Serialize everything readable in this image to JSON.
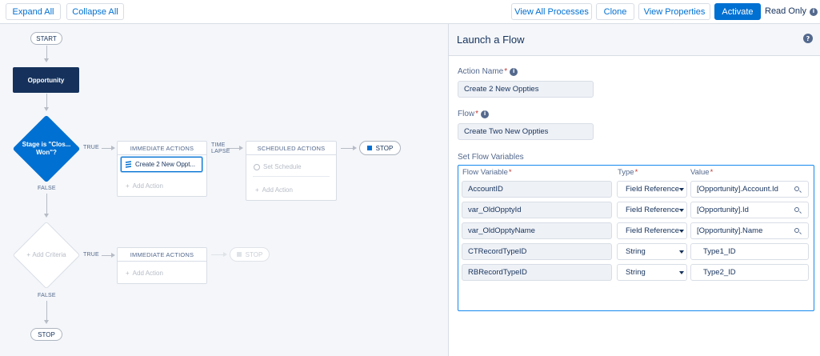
{
  "toolbar": {
    "expand_all": "Expand All",
    "collapse_all": "Collapse All",
    "view_all_processes": "View All Processes",
    "clone": "Clone",
    "view_properties": "View Properties",
    "activate": "Activate",
    "read_only": "Read Only"
  },
  "canvas": {
    "start": "START",
    "object_node": "Opportunity",
    "criteria_1": "Stage is \"Clos... Won\"?",
    "true_1": "TRUE",
    "false_1": "FALSE",
    "immediate_actions_1": "IMMEDIATE ACTIONS",
    "action_item": "Create 2 New Oppt...",
    "add_action_1": "Add Action",
    "time_lapse": "TIME LAPSE",
    "scheduled_actions": "SCHEDULED ACTIONS",
    "set_schedule": "Set Schedule",
    "add_action_2": "Add Action",
    "stop_1": "STOP",
    "criteria_2": "Add Criteria",
    "true_2": "TRUE",
    "false_2": "FALSE",
    "immediate_actions_2": "IMMEDIATE ACTIONS",
    "add_action_3": "Add Action",
    "stop_2": "STOP",
    "stop_3": "STOP"
  },
  "panel": {
    "title": "Launch a Flow",
    "action_name_label": "Action Name",
    "action_name_value": "Create 2 New Oppties",
    "flow_label": "Flow",
    "flow_value": "Create Two New Oppties",
    "set_flow_variables": "Set Flow Variables",
    "columns": {
      "flow_variable": "Flow Variable",
      "type": "Type",
      "value": "Value"
    },
    "rows": [
      {
        "variable": "AccountID",
        "type": "Field Reference",
        "value": "[Opportunity].Account.Id",
        "lookup": true
      },
      {
        "variable": "var_OldOpptyId",
        "type": "Field Reference",
        "value": "[Opportunity].Id",
        "lookup": true
      },
      {
        "variable": "var_OldOpptyName",
        "type": "Field Reference",
        "value": "[Opportunity].Name",
        "lookup": true
      },
      {
        "variable": "CTRecordTypeID",
        "type": "String",
        "value": "Type1_ID",
        "lookup": false
      },
      {
        "variable": "RBRecordTypeID",
        "type": "String",
        "value": "Type2_ID",
        "lookup": false
      }
    ]
  },
  "colors": {
    "brand_blue": "#0070d2",
    "navy": "#16325c",
    "required_red": "#c23934",
    "canvas_bg": "#f4f6f9"
  }
}
